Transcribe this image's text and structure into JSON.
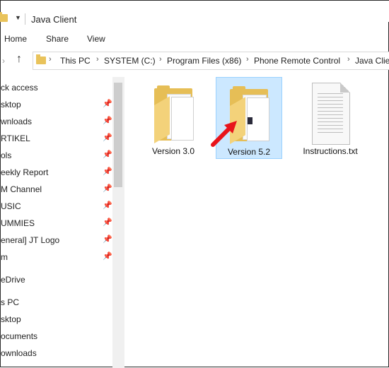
{
  "window": {
    "title": "Java Client"
  },
  "ribbon": {
    "tabs": [
      "Home",
      "Share",
      "View"
    ]
  },
  "address": {
    "crumbs": [
      "This PC",
      "SYSTEM (C:)",
      "Program Files (x86)",
      "Phone Remote Control",
      "Java Clien"
    ]
  },
  "nav": {
    "items": [
      {
        "label": "ck access",
        "pinned": false
      },
      {
        "label": "sktop",
        "pinned": true
      },
      {
        "label": "wnloads",
        "pinned": true
      },
      {
        "label": "RTIKEL",
        "pinned": true
      },
      {
        "label": "ols",
        "pinned": true
      },
      {
        "label": "eekly Report",
        "pinned": true
      },
      {
        "label": "M Channel",
        "pinned": true
      },
      {
        "label": "USIC",
        "pinned": true
      },
      {
        "label": "UMMIES",
        "pinned": true
      },
      {
        "label": "eneral] JT Logo",
        "pinned": true
      },
      {
        "label": "m",
        "pinned": true
      },
      {
        "label": "eDrive",
        "pinned": false
      },
      {
        "label": "s PC",
        "pinned": false
      },
      {
        "label": "sktop",
        "pinned": false
      },
      {
        "label": "ocuments",
        "pinned": false
      },
      {
        "label": "ownloads",
        "pinned": false
      }
    ]
  },
  "files": [
    {
      "name": "Version 3.0",
      "kind": "folder",
      "selected": false
    },
    {
      "name": "Version 5.2",
      "kind": "folder",
      "selected": true
    },
    {
      "name": "Instructions.txt",
      "kind": "text-file",
      "selected": false
    }
  ],
  "colors": {
    "selection_bg": "#cce8ff",
    "selection_border": "#99d1ff",
    "arrow": "#e8141b"
  }
}
